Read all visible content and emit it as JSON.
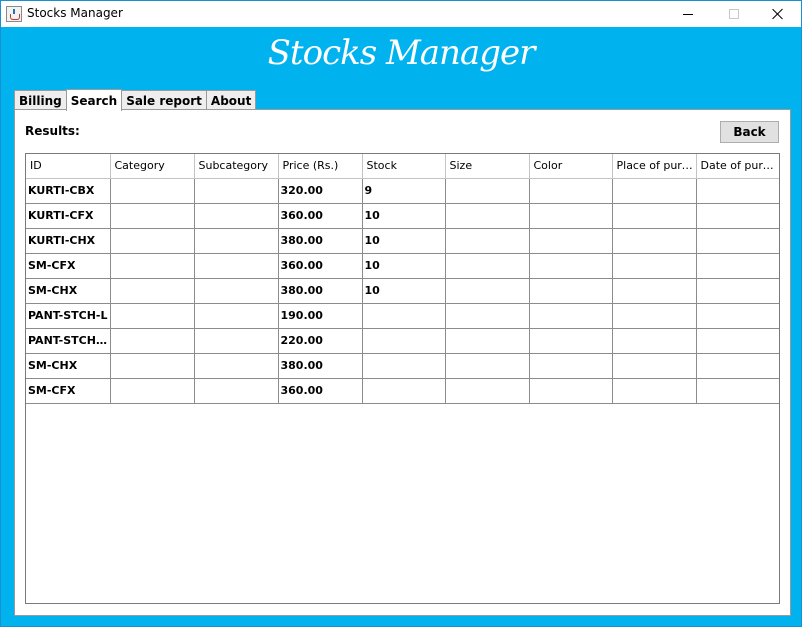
{
  "window": {
    "title": "Stocks Manager",
    "icon": "java-cup-icon",
    "controls": [
      "minimize-icon",
      "maximize-icon",
      "close-icon"
    ]
  },
  "banner": {
    "title": "Stocks Manager"
  },
  "tabs": [
    {
      "label": "Billing",
      "active": false
    },
    {
      "label": "Search",
      "active": true
    },
    {
      "label": "Sale report",
      "active": false
    },
    {
      "label": "About",
      "active": false
    }
  ],
  "results": {
    "label": "Results:",
    "back_label": "Back"
  },
  "table": {
    "columns": [
      "ID",
      "Category",
      "Subcategory",
      "Price (Rs.)",
      "Stock",
      "Size",
      "Color",
      "Place of purc...",
      "Date of purc..."
    ],
    "rows": [
      [
        "KURTI-CBX",
        "",
        "",
        "320.00",
        "9",
        "",
        "",
        "",
        ""
      ],
      [
        "KURTI-CFX",
        "",
        "",
        "360.00",
        "10",
        "",
        "",
        "",
        ""
      ],
      [
        "KURTI-CHX",
        "",
        "",
        "380.00",
        "10",
        "",
        "",
        "",
        ""
      ],
      [
        "SM-CFX",
        "",
        "",
        "360.00",
        "10",
        "",
        "",
        "",
        ""
      ],
      [
        "SM-CHX",
        "",
        "",
        "380.00",
        "10",
        "",
        "",
        "",
        ""
      ],
      [
        "PANT-STCH-L",
        "",
        "",
        "190.00",
        "",
        "",
        "",
        "",
        ""
      ],
      [
        "PANT-STCH-...",
        "",
        "",
        "220.00",
        "",
        "",
        "",
        "",
        ""
      ],
      [
        "SM-CHX",
        "",
        "",
        "380.00",
        "",
        "",
        "",
        "",
        ""
      ],
      [
        "SM-CFX",
        "",
        "",
        "360.00",
        "",
        "",
        "",
        "",
        ""
      ]
    ]
  },
  "colors": {
    "background": "#00b2ee",
    "panel": "#ffffff",
    "button": "#e1e1e1"
  }
}
